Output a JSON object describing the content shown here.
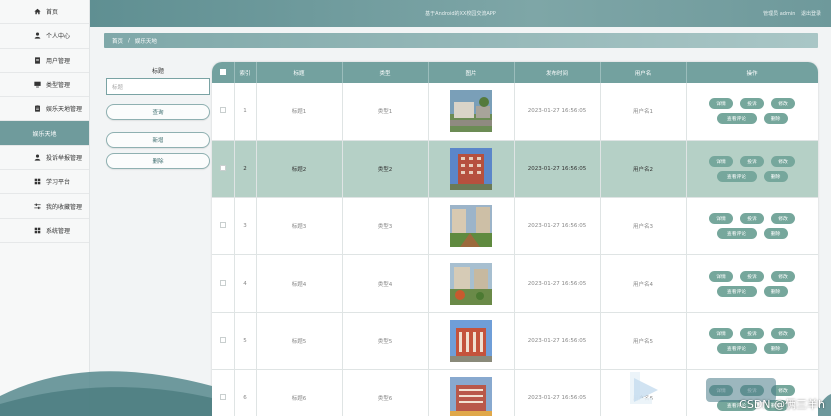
{
  "sidebar": {
    "items": [
      {
        "label": "首页",
        "icon": "home-icon"
      },
      {
        "label": "个人中心",
        "icon": "user-icon"
      },
      {
        "label": "用户管理",
        "icon": "document-icon"
      },
      {
        "label": "类型管理",
        "icon": "monitor-icon"
      },
      {
        "label": "娱乐天地管理",
        "icon": "clipboard-icon"
      },
      {
        "label": "娱乐天地",
        "icon": ""
      },
      {
        "label": "投诉举报管理",
        "icon": "user-icon"
      },
      {
        "label": "学习平台",
        "icon": "grid-icon"
      },
      {
        "label": "我的收藏管理",
        "icon": "sliders-icon"
      },
      {
        "label": "系统管理",
        "icon": "grid-icon"
      }
    ],
    "active_index": 5
  },
  "topbar": {
    "title": "基于Android的XX校园交流APP",
    "user": "管理员 admin",
    "logout": "退出登录"
  },
  "breadcrumb": {
    "home": "首页",
    "separator": "/",
    "current": "娱乐天地"
  },
  "search": {
    "label": "标题",
    "placeholder": "标题",
    "query_button": "查询",
    "add_button": "新增",
    "delete_button": "删除"
  },
  "table": {
    "headers": [
      "",
      "索引",
      "标题",
      "类型",
      "图片",
      "发布时间",
      "用户名",
      "操作"
    ],
    "rows": [
      {
        "index": "1",
        "title": "标题1",
        "type": "类型1",
        "time": "2023-01-27 16:56:05",
        "user": "用户名1"
      },
      {
        "index": "2",
        "title": "标题2",
        "type": "类型2",
        "time": "2023-01-27 16:56:05",
        "user": "用户名2"
      },
      {
        "index": "3",
        "title": "标题3",
        "type": "类型3",
        "time": "2023-01-27 16:56:05",
        "user": "用户名3"
      },
      {
        "index": "4",
        "title": "标题4",
        "type": "类型4",
        "time": "2023-01-27 16:56:05",
        "user": "用户名4"
      },
      {
        "index": "5",
        "title": "标题5",
        "type": "类型5",
        "time": "2023-01-27 16:56:05",
        "user": "用户名5"
      },
      {
        "index": "6",
        "title": "标题6",
        "type": "类型6",
        "time": "2023-01-27 16:56:05",
        "user": "用户名6"
      }
    ],
    "highlighted_row": 1,
    "actions": {
      "detail": "详情",
      "report": "投诉",
      "edit": "修改",
      "view_comments": "查看评论",
      "delete": "删除"
    }
  },
  "watermark": "CSDN @俩三羊h",
  "colors": {
    "accent": "#73a19f",
    "highlight_row": "#b5d0c6",
    "action_button": "#76a79c"
  }
}
